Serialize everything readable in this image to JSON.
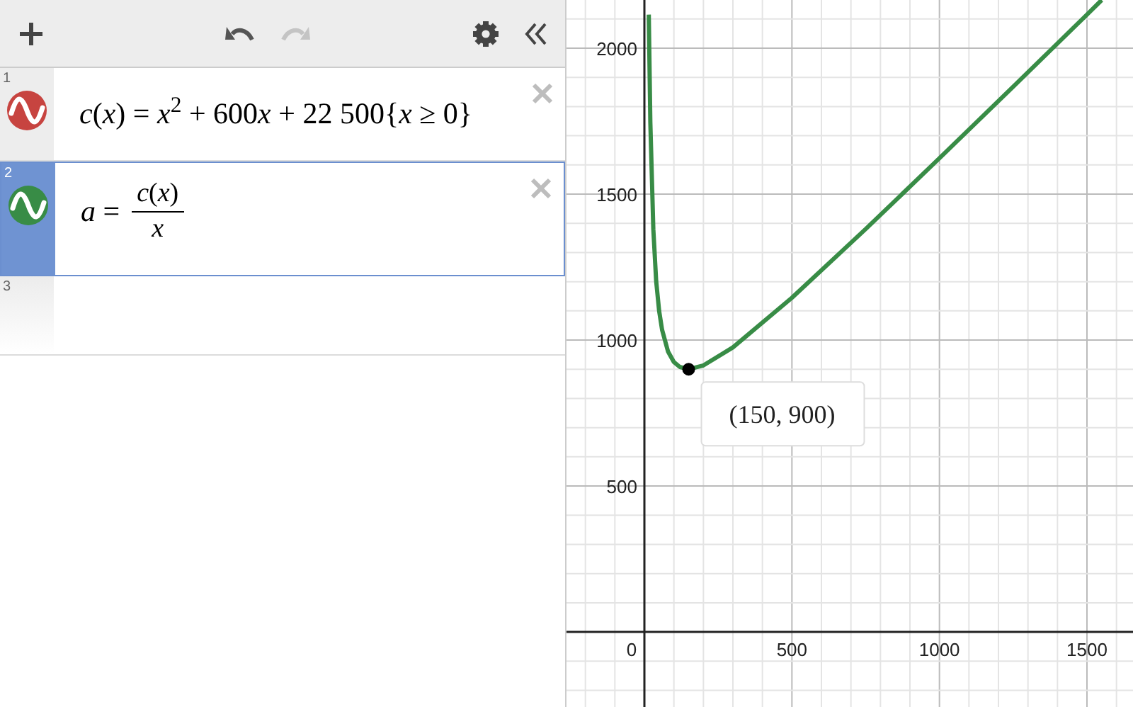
{
  "toolbar": {
    "redo_disabled": true
  },
  "expressions": [
    {
      "index": "1",
      "kind": "equation",
      "color": "#c74440",
      "selected": false,
      "latex": [
        "*c*(*x*) = *x*$^{2}$ + 600",
        "*x* + 22 500{*x* ≥ 0}"
      ]
    },
    {
      "index": "2",
      "kind": "fraction",
      "color": "#388c46",
      "selected": true,
      "lhs": "*a* =",
      "numerator": "*c*(*x*)",
      "denominator": "*x*"
    },
    {
      "index": "3",
      "kind": "empty",
      "selected": false
    }
  ],
  "graph": {
    "chart_data": {
      "type": "line",
      "grid": true,
      "x": [
        15,
        20,
        30,
        40,
        50,
        60,
        80,
        100,
        120,
        150,
        200,
        300,
        500,
        750,
        1000,
        1250,
        1500,
        1550
      ],
      "series": [
        {
          "color": "#388c46",
          "values": [
            2115,
            1745,
            1380,
            1203,
            1100,
            1035,
            961,
            925,
            908,
            900,
            913,
            975,
            1145,
            1380,
            1623,
            1868,
            2115,
            2165
          ]
        }
      ],
      "xlim": [
        -264,
        1656
      ],
      "ylim": [
        -257,
        2165
      ],
      "xticks": [
        0,
        500,
        1000,
        1500
      ],
      "yticks": [
        500,
        1000,
        1500,
        2000
      ],
      "annotations": [
        {
          "text": "(150, 900)",
          "x": 150,
          "y": 900
        }
      ]
    }
  }
}
